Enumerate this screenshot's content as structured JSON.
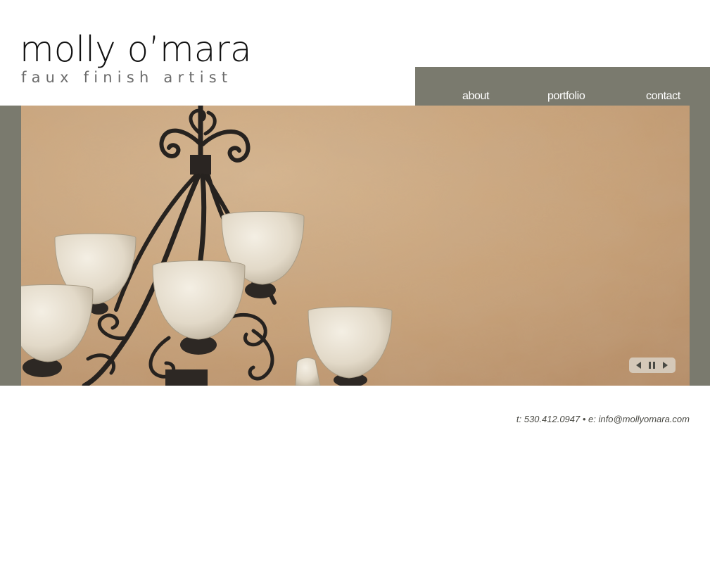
{
  "brand": {
    "name": "molly o’mara",
    "tagline": "faux finish artist"
  },
  "nav": {
    "items": [
      {
        "label": "about"
      },
      {
        "label": "portfolio"
      },
      {
        "label": "contact"
      }
    ]
  },
  "slideshow": {
    "controls": {
      "prev_icon": "triangle-left-icon",
      "pause_icon": "pause-icon",
      "next_icon": "triangle-right-icon"
    }
  },
  "footer": {
    "contact": "t: 530.412.0947 • e: info@mollyomara.com"
  },
  "colors": {
    "band": "#7a7a6e",
    "wall": "#c9a57b",
    "iron": "#26221f",
    "glass": "#e8e1d3"
  }
}
